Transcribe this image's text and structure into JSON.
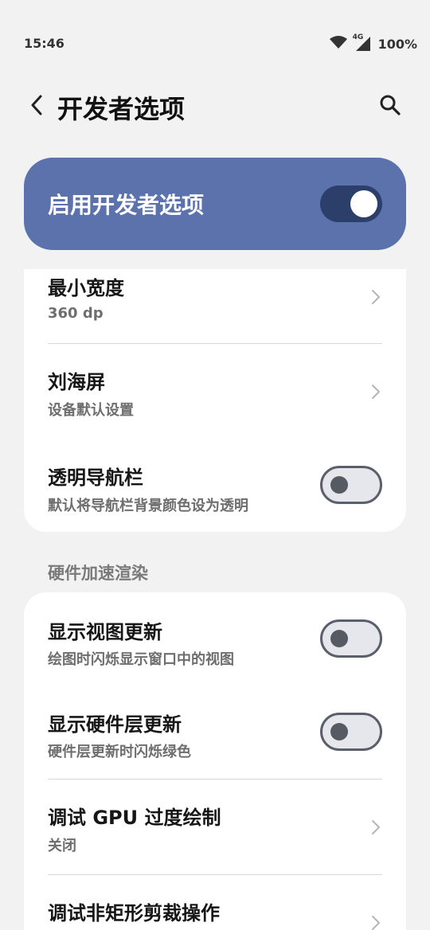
{
  "status_bar": {
    "time": "15:46",
    "network": "4G",
    "battery": "100%"
  },
  "header": {
    "title": "开发者选项"
  },
  "master_switch": {
    "label": "启用开发者选项",
    "enabled": true
  },
  "group1": {
    "items": [
      {
        "title": "最小宽度",
        "subtitle": "360 dp",
        "control": "chevron"
      },
      {
        "title": "刘海屏",
        "subtitle": "设备默认设置",
        "control": "chevron"
      },
      {
        "title": "透明导航栏",
        "subtitle": "默认将导航栏背景颜色设为透明",
        "control": "toggle",
        "on": false
      }
    ]
  },
  "section2": {
    "header": "硬件加速渲染",
    "items": [
      {
        "title": "显示视图更新",
        "subtitle": "绘图时闪烁显示窗口中的视图",
        "control": "toggle",
        "on": false
      },
      {
        "title": "显示硬件层更新",
        "subtitle": "硬件层更新时闪烁绿色",
        "control": "toggle",
        "on": false
      },
      {
        "title": "调试 GPU 过度绘制",
        "subtitle": "关闭",
        "control": "chevron"
      },
      {
        "title": "调试非矩形剪裁操作",
        "subtitle": "",
        "control": "chevron"
      }
    ]
  },
  "colors": {
    "accent": "#5b72ad",
    "accent_dark": "#2c3f6b",
    "background": "#f2f2f2",
    "card": "#ffffff"
  }
}
